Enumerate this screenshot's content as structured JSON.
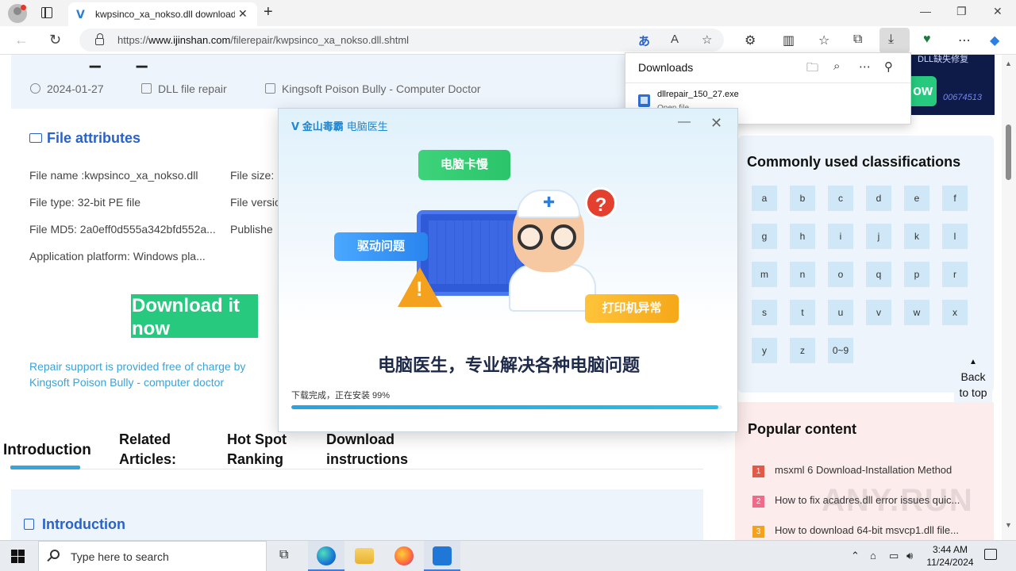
{
  "browser": {
    "tab_title": "kwpsinco_xa_nokso.dll download",
    "url_prefix": "https://",
    "url_domain": "www.ijinshan.com",
    "url_path": "/filerepair/kwpsinco_xa_nokso.dll.shtml"
  },
  "downloads": {
    "title": "Downloads",
    "file_name": "dllrepair_150_27.exe",
    "file_status": "Open file"
  },
  "page": {
    "meta": {
      "date": "2024-01-27",
      "category": "DLL file repair",
      "source": "Kingsoft Poison Bully - Computer Doctor"
    },
    "attributes_title": "File attributes",
    "attributes": [
      "File name :kwpsinco_xa_nokso.dll",
      "File type: 32-bit PE file",
      "File MD5: 2a0eff0d555a342bfd552a...",
      "Application platform: Windows pla..."
    ],
    "attributes_right": [
      "File size:",
      "File versio",
      "Publishe"
    ],
    "download_button": "Download it now",
    "repair_note": "Repair support is provided free of charge by Kingsoft Poison Bully - computer doctor",
    "subnav": [
      "Introduction",
      "Related Articles:",
      "Hot Spot Ranking",
      "Download instructions"
    ],
    "intro_title": "Introduction",
    "banner_text": "DLL缺失修复",
    "banner_btn": "ow",
    "banner_num": "00674513",
    "classifications_title": "Commonly used classifications",
    "letters": [
      "a",
      "b",
      "c",
      "d",
      "e",
      "f",
      "g",
      "h",
      "i",
      "j",
      "k",
      "l",
      "m",
      "n",
      "o",
      "q",
      "p",
      "r",
      "s",
      "t",
      "u",
      "v",
      "w",
      "x",
      "y",
      "z",
      "0~9"
    ],
    "back_to_top": "Back to top",
    "popular_title": "Popular content",
    "popular": [
      {
        "num": "1",
        "text": "msxml 6 Download-Installation Method"
      },
      {
        "num": "2",
        "text": "How to fix acadres.dll error issues quic..."
      },
      {
        "num": "3",
        "text": "How to download 64-bit msvcp1.dll file..."
      }
    ],
    "watermark": "ANY.RUN"
  },
  "installer": {
    "logo": "金山毒霸",
    "logo_sub": "电脑医生",
    "tag_slow": "电脑卡慢",
    "tag_driver": "驱动问题",
    "tag_printer": "打印机异常",
    "slogan": "电脑医生，专业解决各种电脑问题",
    "status": "下载完成，正在安装 99%",
    "progress": 0.99
  },
  "taskbar": {
    "search_placeholder": "Type here to search",
    "time": "3:44 AM",
    "date": "11/24/2024"
  },
  "colors": {
    "accent_blue": "#2a62c8",
    "download_green": "#27c97f",
    "link_cyan": "#3aa3d8",
    "letter_chip": "#cfe7f7"
  }
}
